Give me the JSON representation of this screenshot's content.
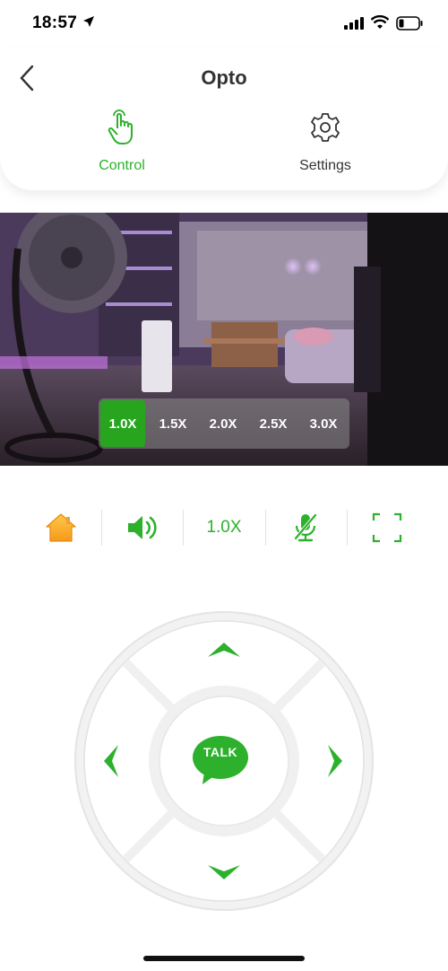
{
  "status_bar": {
    "time": "18:57",
    "location_icon": "location-arrow-icon",
    "signal_icon": "cellular-signal-icon",
    "wifi_icon": "wifi-icon",
    "battery_icon": "battery-low-icon"
  },
  "header": {
    "back_icon": "chevron-left-icon",
    "title": "Opto",
    "tabs": [
      {
        "label": "Control",
        "icon": "hand-pointer-icon",
        "active": true
      },
      {
        "label": "Settings",
        "icon": "gear-icon",
        "active": false
      }
    ]
  },
  "video": {
    "zoom_options": [
      "1.0X",
      "1.5X",
      "2.0X",
      "2.5X",
      "3.0X"
    ],
    "selected_zoom": "1.0X"
  },
  "toolbar": {
    "home_icon": "home-icon",
    "speaker_icon": "speaker-icon",
    "zoom_readout": "1.0X",
    "mic_icon": "microphone-muted-icon",
    "fullscreen_icon": "fullscreen-icon"
  },
  "dpad": {
    "talk_label": "TALK",
    "up_icon": "chevron-up-icon",
    "down_icon": "chevron-down-icon",
    "left_icon": "chevron-left-icon",
    "right_icon": "chevron-right-icon"
  },
  "colors": {
    "accent": "#2db12d",
    "zoom_active": "#27a51f",
    "home_icon": "#f5a623"
  }
}
